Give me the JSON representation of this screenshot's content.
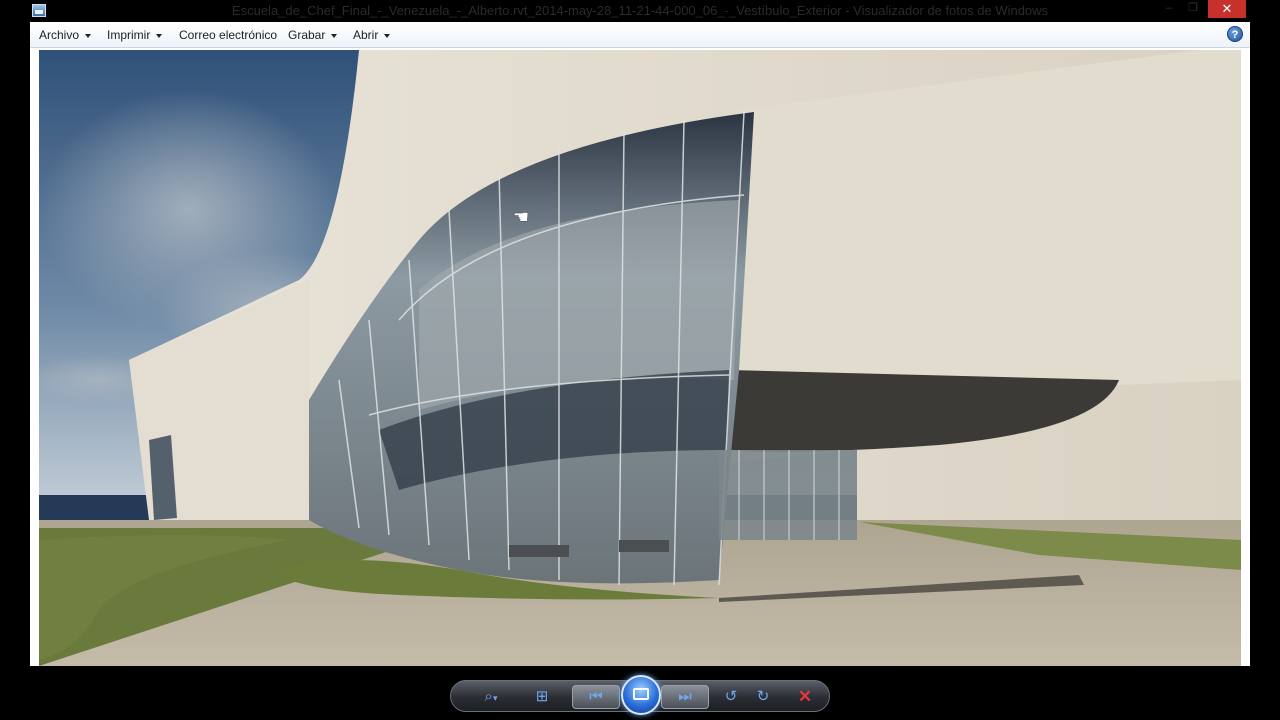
{
  "window": {
    "title": "Escuela_de_Chef_Final_-_Venezuela_-_Alberto.rvt_2014-may-28_11-21-44-000_06_-_Vestíbulo_Exterior - Visualizador de fotos de Windows",
    "minimize_glyph": "–",
    "maximize_glyph": "❐",
    "close_glyph": "✕"
  },
  "menu": {
    "items": [
      {
        "label": "Archivo",
        "has_dropdown": true
      },
      {
        "label": "Imprimir",
        "has_dropdown": true
      },
      {
        "label": "Correo electrónico",
        "has_dropdown": false
      },
      {
        "label": "Grabar",
        "has_dropdown": true
      },
      {
        "label": "Abrir",
        "has_dropdown": true
      }
    ],
    "help_label": "?"
  },
  "photo": {
    "description_icon": "architectural-render-image",
    "colors": {
      "sky_top": "#3d5f86",
      "sky_bottom": "#b8c7d6",
      "facade": "#ddd6c8",
      "glass": "#5f6f7a",
      "lawn": "#6a7a3c",
      "paving": "#b6ae9c"
    }
  },
  "controls": {
    "zoom_icon": "magnifier-icon",
    "actual_size_icon": "fit-window-icon",
    "previous_icon": "previous-icon",
    "slideshow_icon": "slideshow-icon",
    "next_icon": "next-icon",
    "rotate_ccw_icon": "rotate-counterclockwise-icon",
    "rotate_cw_icon": "rotate-clockwise-icon",
    "delete_icon": "delete-icon",
    "zoom_glyph": "⌕",
    "zoom_caret": "▾",
    "fit_glyph": "⊞",
    "prev_glyph": "⏮",
    "next_glyph": "⏭",
    "rotate_ccw_glyph": "↺",
    "rotate_cw_glyph": "↻",
    "delete_glyph": "✕"
  },
  "cursor": {
    "icon": "hand-pointer-icon",
    "glyph": "☚"
  }
}
